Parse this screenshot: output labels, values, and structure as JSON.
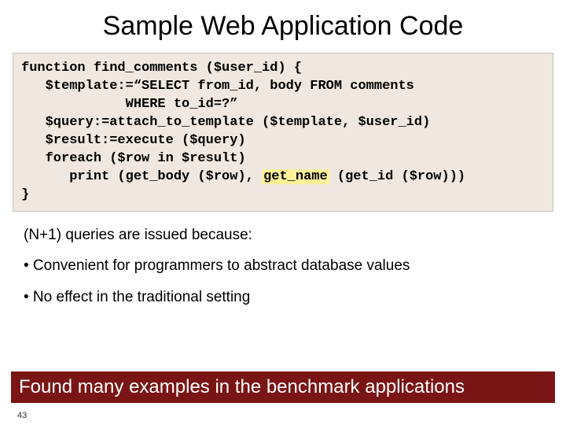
{
  "title": "Sample Web Application Code",
  "code": {
    "l1a": "function",
    "l1b": " find_comments ($user_id) {",
    "l2": "   $template:=“SELECT from_id, body FROM comments",
    "l3": "             WHERE to_id=?”",
    "l4": "   $query:=attach_to_template ($template, $user_id)",
    "l5": "   $result:=execute ($query)",
    "l6": "   foreach ($row in $result)",
    "l7a": "      print (get_body ($row), ",
    "l7_hl": "get_name",
    "l7b": " (get_id ($row)))",
    "l8": "}"
  },
  "body": {
    "intro": "(N+1) queries are issued because:",
    "b1": "• Convenient for programmers to abstract database values",
    "b2": "• No effect in the traditional setting"
  },
  "footer": "Found many examples in the benchmark applications",
  "page": "43"
}
